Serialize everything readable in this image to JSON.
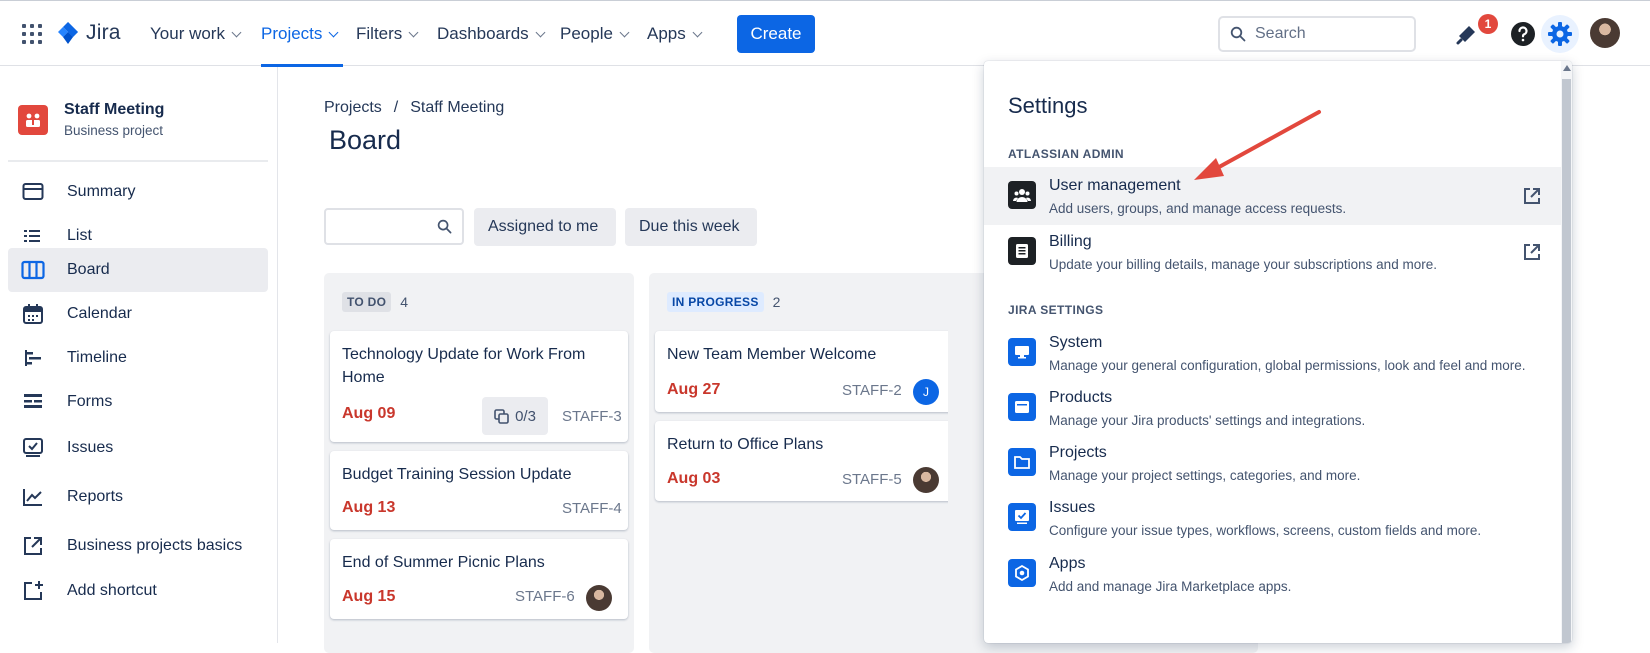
{
  "topbar": {
    "logo_text": "Jira",
    "nav": [
      {
        "label": "Your work",
        "active": false
      },
      {
        "label": "Projects",
        "active": true
      },
      {
        "label": "Filters",
        "active": false
      },
      {
        "label": "Dashboards",
        "active": false
      },
      {
        "label": "People",
        "active": false
      },
      {
        "label": "Apps",
        "active": false
      }
    ],
    "create_label": "Create",
    "search_placeholder": "Search",
    "notification_count": "1",
    "icons": [
      "app-switcher-icon",
      "jira-logo-icon",
      "search-icon",
      "notification-icon",
      "help-icon",
      "settings-gear-icon",
      "user-avatar"
    ]
  },
  "sidebar": {
    "project_name": "Staff Meeting",
    "project_type": "Business project",
    "items": [
      {
        "label": "Summary",
        "icon": "summary-icon",
        "active": false
      },
      {
        "label": "List",
        "icon": "list-icon",
        "active": false
      },
      {
        "label": "Board",
        "icon": "board-icon",
        "active": true
      },
      {
        "label": "Calendar",
        "icon": "calendar-icon",
        "active": false
      },
      {
        "label": "Timeline",
        "icon": "timeline-icon",
        "active": false
      },
      {
        "label": "Forms",
        "icon": "forms-icon",
        "active": false
      },
      {
        "label": "Issues",
        "icon": "issues-icon",
        "active": false
      },
      {
        "label": "Reports",
        "icon": "reports-icon",
        "active": false
      },
      {
        "label": "Business projects basics",
        "icon": "external-link-icon",
        "active": false
      },
      {
        "label": "Add shortcut",
        "icon": "add-shortcut-icon",
        "active": false
      }
    ]
  },
  "main": {
    "breadcrumb": {
      "projects": "Projects",
      "separator": "/",
      "project": "Staff Meeting"
    },
    "title": "Board",
    "filters": {
      "assigned_to_me": "Assigned to me",
      "due_this_week": "Due this week"
    },
    "columns": [
      {
        "name": "TO DO",
        "count": "4",
        "cards": [
          {
            "title": "Technology Update for Work From Home",
            "date": "Aug 09",
            "key": "STAFF-3",
            "subtasks": "0/3"
          },
          {
            "title": "Budget Training Session Update",
            "date": "Aug 13",
            "key": "STAFF-4"
          },
          {
            "title": "End of Summer Picnic Plans",
            "date": "Aug 15",
            "key": "STAFF-6",
            "assignee": "photo"
          }
        ]
      },
      {
        "name": "IN PROGRESS",
        "count": "2",
        "cards": [
          {
            "title": "New Team Member Welcome",
            "date": "Aug 27",
            "key": "STAFF-2",
            "assignee_initial": "J"
          },
          {
            "title": "Return to Office Plans",
            "date": "Aug 03",
            "key": "STAFF-5",
            "assignee": "photo"
          }
        ]
      }
    ]
  },
  "settings_panel": {
    "title": "Settings",
    "atlassian_admin": {
      "heading": "ATLASSIAN ADMIN",
      "items": [
        {
          "title": "User management",
          "desc": "Add users, groups, and manage access requests.",
          "icon": "user-management-icon"
        },
        {
          "title": "Billing",
          "desc": "Update your billing details, manage your subscriptions and more.",
          "icon": "billing-icon"
        }
      ]
    },
    "jira_settings": {
      "heading": "JIRA SETTINGS",
      "items": [
        {
          "title": "System",
          "desc": "Manage your general configuration, global permissions, look and feel and more.",
          "icon": "system-icon"
        },
        {
          "title": "Products",
          "desc": "Manage your Jira products' settings and integrations.",
          "icon": "products-icon"
        },
        {
          "title": "Projects",
          "desc": "Manage your project settings, categories, and more.",
          "icon": "projects-folder-icon"
        },
        {
          "title": "Issues",
          "desc": "Configure your issue types, workflows, screens, custom fields and more.",
          "icon": "issues-settings-icon"
        },
        {
          "title": "Apps",
          "desc": "Add and manage Jira Marketplace apps.",
          "icon": "apps-icon"
        }
      ]
    }
  },
  "colors": {
    "brand_blue": "#0c66e4",
    "due_red": "#c9372c",
    "badge_red": "#e2483d",
    "annotation_arrow": "#e2483d"
  }
}
